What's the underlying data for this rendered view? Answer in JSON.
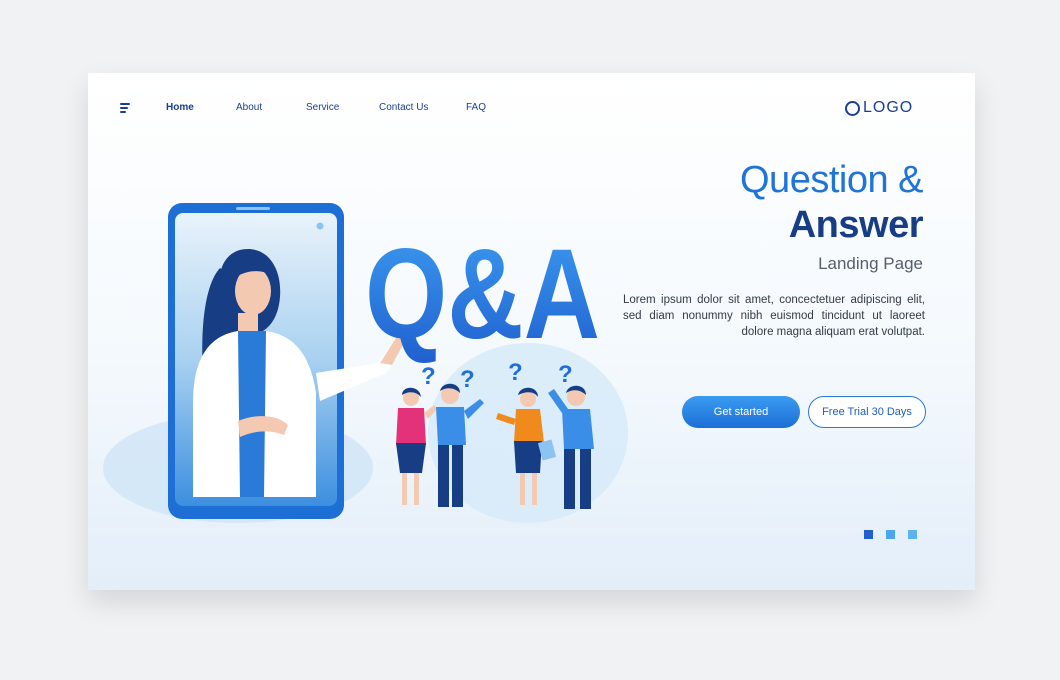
{
  "nav": {
    "items": [
      {
        "label": "Home",
        "active": true
      },
      {
        "label": "About",
        "active": false
      },
      {
        "label": "Service",
        "active": false
      },
      {
        "label": "Contact Us",
        "active": false
      },
      {
        "label": "FAQ",
        "active": false
      }
    ],
    "logo": "LOGO"
  },
  "hero": {
    "title_line1": "Question &",
    "title_line2": "Answer",
    "subtitle": "Landing Page",
    "description": "Lorem ipsum dolor sit amet, concectetuer adipiscing elit, sed diam nonummy nibh euismod tincidunt ut laoreet dolore magna aliquam erat volutpat.",
    "qa_text": "Q&A",
    "primary_button": "Get started",
    "secondary_button": "Free Trial 30 Days"
  },
  "slider": {
    "dots": [
      {
        "active": true,
        "color": "#1f5fd0"
      },
      {
        "active": false,
        "color": "#4aa6ef"
      },
      {
        "active": false,
        "color": "#5bb3f2"
      }
    ]
  },
  "colors": {
    "brand_dark": "#173d85",
    "brand_blue": "#1f74d8",
    "accent_light": "#4aa6ef"
  },
  "icons": [
    "menu-icon",
    "logo-circle-icon",
    "question-mark-icon"
  ]
}
